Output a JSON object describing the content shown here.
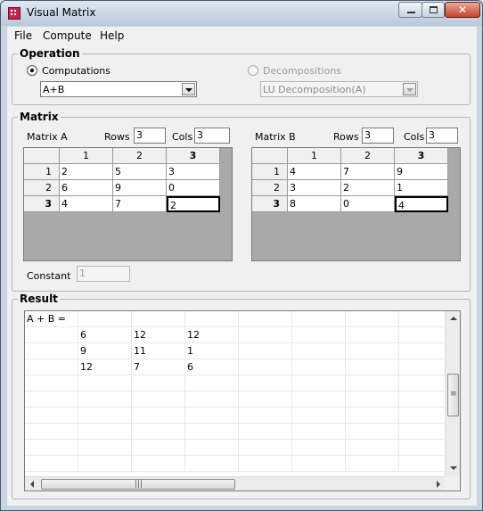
{
  "window": {
    "title": "Visual Matrix"
  },
  "menu": {
    "items": [
      {
        "label": "File"
      },
      {
        "label": "Compute"
      },
      {
        "label": "Help"
      }
    ]
  },
  "operation": {
    "group_label": "Operation",
    "computations_label": "Computations",
    "computations_selected": true,
    "computations_value": "A+B",
    "decompositions_label": "Decompositions",
    "decompositions_value": "LU Decomposition(A)"
  },
  "matrix": {
    "group_label": "Matrix",
    "rows_label": "Rows",
    "cols_label": "Cols",
    "a": {
      "label": "Matrix A",
      "rows": "3",
      "cols": "3",
      "col_headers": [
        "1",
        "2",
        "3"
      ],
      "row_headers": [
        "1",
        "2",
        "3"
      ],
      "cells": [
        [
          "2",
          "5",
          "3"
        ],
        [
          "6",
          "9",
          "0"
        ],
        [
          "4",
          "7",
          "2"
        ]
      ]
    },
    "b": {
      "label": "Matrix B",
      "rows": "3",
      "cols": "3",
      "col_headers": [
        "1",
        "2",
        "3"
      ],
      "row_headers": [
        "1",
        "2",
        "3"
      ],
      "cells": [
        [
          "4",
          "7",
          "9"
        ],
        [
          "3",
          "2",
          "1"
        ],
        [
          "8",
          "0",
          "4"
        ]
      ]
    },
    "constant_label": "Constant",
    "constant_value": "1"
  },
  "result": {
    "group_label": "Result",
    "expression": "A + B =",
    "rows": [
      [
        "6",
        "12",
        "12"
      ],
      [
        "9",
        "11",
        "1"
      ],
      [
        "12",
        "7",
        "6"
      ]
    ]
  },
  "icons": {
    "app": "matrix-icon",
    "minimize": "minimize-icon",
    "maximize": "maximize-icon",
    "close": "close-icon"
  }
}
